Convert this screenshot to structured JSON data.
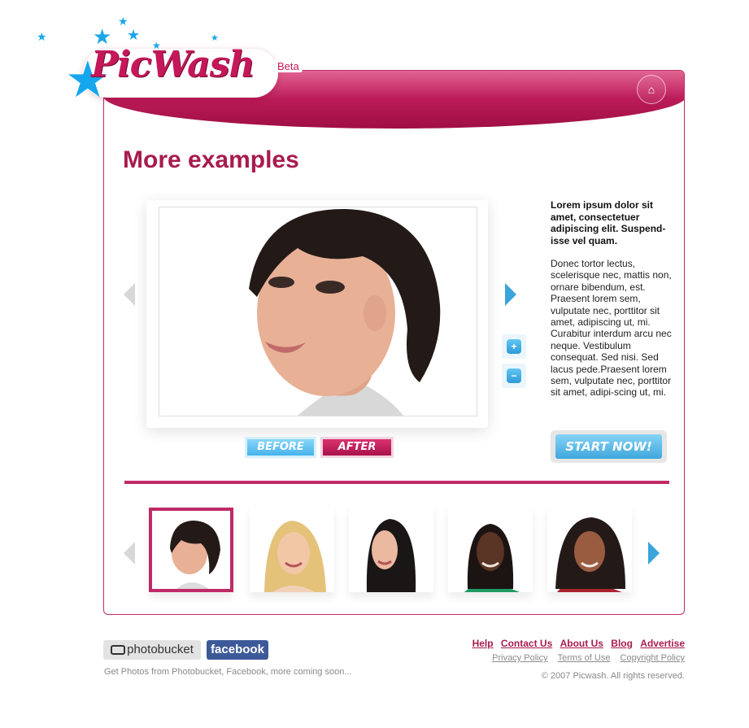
{
  "brand": {
    "logo_text": "PicWash",
    "beta_label": "Beta",
    "accent_color": "#c02a66",
    "blue_color": "#3aa4dc"
  },
  "header": {
    "home_icon": "home-icon"
  },
  "main": {
    "title": "More examples",
    "viewer": {
      "before_label": "BEFORE",
      "after_label": "AFTER",
      "zoom_in_icon": "zoom-in-icon",
      "zoom_out_icon": "zoom-out-icon",
      "prev_icon": "arrow-left-icon",
      "next_icon": "arrow-right-icon"
    },
    "side": {
      "heading": "Lorem ipsum dolor sit amet, consectetuer adipiscing elit. Suspend-isse vel quam.",
      "body": "Donec tortor lectus, scelerisque nec, mattis non, ornare bibendum, est. Praesent lorem sem, vulputate nec, porttitor sit amet, adipiscing ut, mi. Curabitur interdum arcu nec neque. Vestibulum consequat. Sed nisi. Sed lacus pede.Praesent lorem sem, vulputate nec, porttitor sit amet, adipi-scing ut, mi.",
      "start_label": "START NOW!"
    },
    "thumbnails": [
      {
        "name": "thumb-short-dark-hair",
        "selected": true
      },
      {
        "name": "thumb-blonde",
        "selected": false
      },
      {
        "name": "thumb-long-black-hair",
        "selected": false
      },
      {
        "name": "thumb-braids",
        "selected": false
      },
      {
        "name": "thumb-dark-curly-hair",
        "selected": false
      }
    ]
  },
  "footer": {
    "photobucket_label": "photobucket",
    "facebook_label": "facebook",
    "source_note": "Get Photos from Photobucket, Facebook, more coming soon...",
    "links": [
      "Help",
      "Contact Us",
      "About Us",
      "Blog",
      "Advertise"
    ],
    "policies": [
      "Privacy Policy",
      "Terms of Use",
      "Copyright Policy"
    ],
    "copyright": "© 2007 Picwash. All rights reserved."
  }
}
